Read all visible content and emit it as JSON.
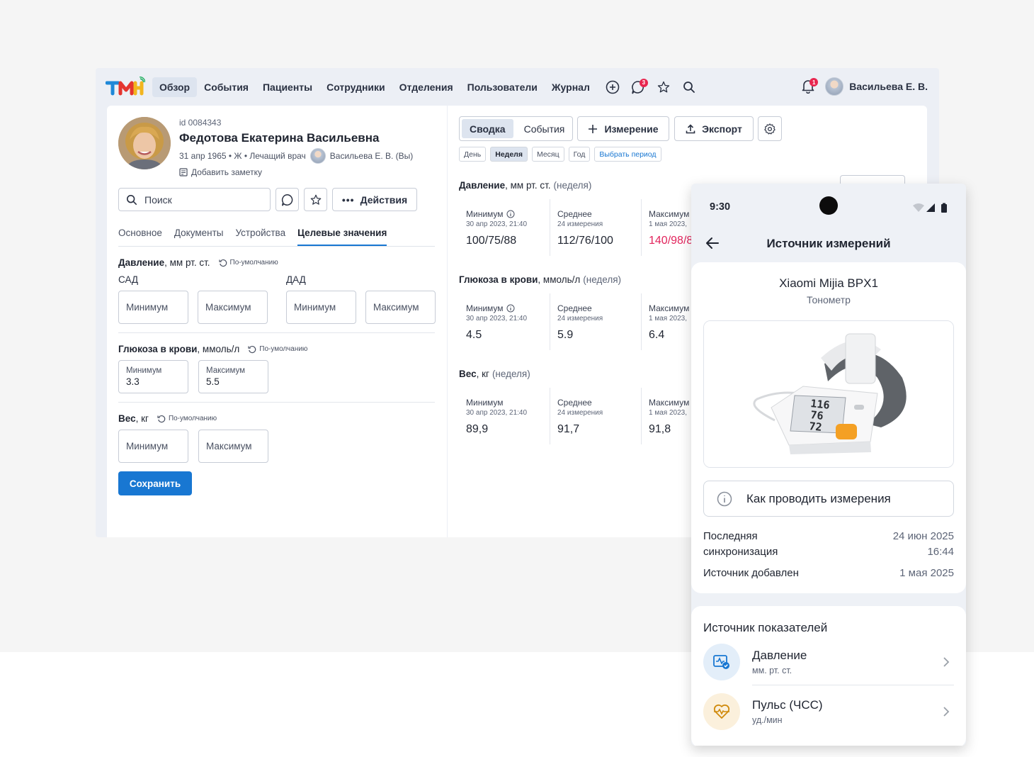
{
  "nav": {
    "items": [
      "Обзор",
      "События",
      "Пациенты",
      "Сотрудники",
      "Отделения",
      "Пользователи",
      "Журнал"
    ],
    "chat_badge": "3",
    "bell_badge": "1",
    "user_name": "Васильева Е. В."
  },
  "patient": {
    "id": "id 0084343",
    "name": "Федотова Екатерина Васильевна",
    "meta": "31 апр 1965 • Ж • Лечащий врач",
    "doctor": "Васильева Е. В. (Вы)",
    "add_note": "Добавить заметку"
  },
  "toolbar": {
    "search_placeholder": "Поиск",
    "actions": "Действия"
  },
  "tabs": [
    "Основное",
    "Документы",
    "Устройства",
    "Целевые значения"
  ],
  "targets": {
    "reset": "По-умолчанию",
    "pressure": {
      "title": "Давление",
      "unit": ", мм рт. ст.",
      "sad": "САД",
      "dad": "ДАД"
    },
    "glucose": {
      "title": "Глюкоза в крови",
      "unit": ", ммоль/л",
      "min_label": "Минимум",
      "min_value": "3.3",
      "max_label": "Максимум",
      "max_value": "5.5"
    },
    "weight": {
      "title": "Вес",
      "unit": ", кг"
    },
    "min": "Минимум",
    "max": "Максимум",
    "save": "Сохранить"
  },
  "summary": {
    "seg": [
      "Сводка",
      "События"
    ],
    "measure_btn": "Измерение",
    "export_btn": "Экспорт",
    "periods": [
      "День",
      "Неделя",
      "Месяц",
      "Год",
      "Выбрать период"
    ],
    "period_note": "(неделя)",
    "cells": {
      "min": "Минимум",
      "avg": "Среднее",
      "max": "Максимум",
      "min_date": "30 апр 2023, 21:40",
      "avg_count": "24 измерения",
      "max_date": "1 мая 2023,"
    },
    "pressure": {
      "title": "Давление",
      "unit": ", мм рт. ст.",
      "min": "100/75/88",
      "avg": "112/76/100",
      "max": "140/98/8"
    },
    "glucose": {
      "title": "Глюкоза в крови",
      "unit": ", ммоль/л",
      "min": "4.5",
      "avg": "5.9",
      "max": "6.4"
    },
    "weight": {
      "title": "Вес",
      "unit": ", кг",
      "min": "89,9",
      "avg": "91,7",
      "max": "91,8"
    }
  },
  "phone": {
    "time": "9:30",
    "title": "Источник измерений",
    "device_name": "Xiaomi Mijia BPX1",
    "device_type": "Тонометр",
    "screen_values": [
      "116",
      "76",
      "72"
    ],
    "howto": "Как проводить измерения",
    "last_sync_label": "Последняя синхронизация",
    "last_sync_date": "24 июн 2025",
    "last_sync_time": "16:44",
    "added_label": "Источник добавлен",
    "added_date": "1 мая 2025",
    "sources_title": "Источник показателей",
    "sources": [
      {
        "name": "Давление",
        "unit": "мм. рт. ст."
      },
      {
        "name": "Пульс (ЧСС)",
        "unit": "уд./мин"
      }
    ]
  },
  "colors": {
    "accent": "#1877d2",
    "danger": "#e2245c",
    "badge": "#e8264f"
  }
}
